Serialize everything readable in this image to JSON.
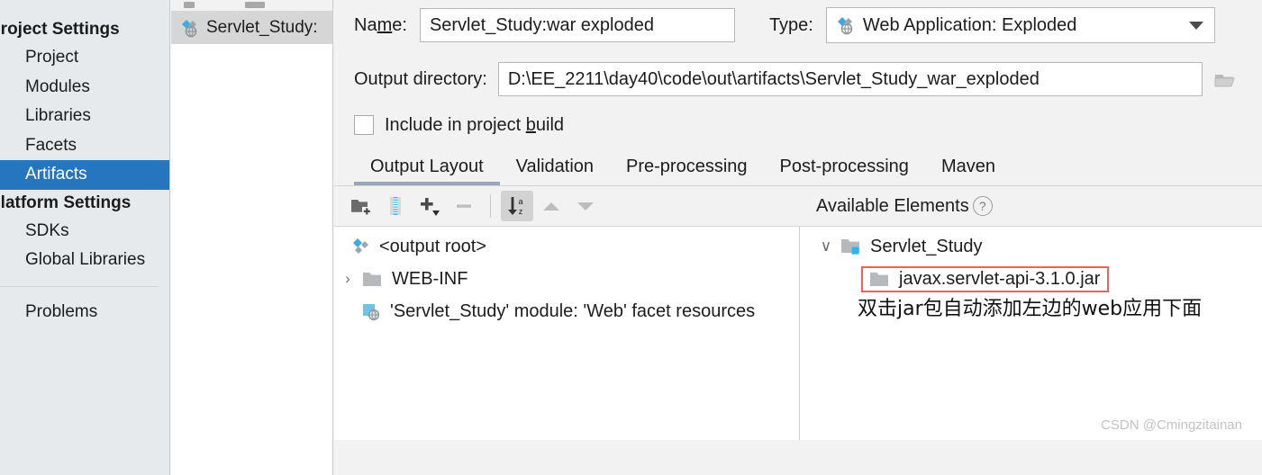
{
  "sidebar": {
    "groups": [
      {
        "label": "Project Settings",
        "items": [
          {
            "label": "Project",
            "selected": false
          },
          {
            "label": "Modules",
            "selected": false
          },
          {
            "label": "Libraries",
            "selected": false
          },
          {
            "label": "Facets",
            "selected": false
          },
          {
            "label": "Artifacts",
            "selected": true
          }
        ]
      },
      {
        "label": "Platform Settings",
        "items": [
          {
            "label": "SDKs",
            "selected": false
          },
          {
            "label": "Global Libraries",
            "selected": false
          }
        ]
      }
    ],
    "problems_label": "Problems"
  },
  "artifact_list": {
    "items": [
      {
        "label": "Servlet_Study:",
        "icon": "web-application-exploded-icon",
        "selected": true
      }
    ]
  },
  "form": {
    "name_label_pre": "Na",
    "name_label_mnemonic": "m",
    "name_label_post": "e:",
    "name_value": "Servlet_Study:war exploded",
    "type_label": "Type:",
    "type_value": "Web Application: Exploded",
    "output_label": "Output directory:",
    "output_value": "D:\\EE_2211\\day40\\code\\out\\artifacts\\Servlet_Study_war_exploded",
    "browse_icon": "folder-browse-icon",
    "include_label_pre": "Include in project ",
    "include_label_mnemonic": "b",
    "include_label_post": "uild",
    "include_checked": false
  },
  "tabs": [
    {
      "label": "Output Layout",
      "active": true
    },
    {
      "label": "Validation",
      "active": false
    },
    {
      "label": "Pre-processing",
      "active": false
    },
    {
      "label": "Post-processing",
      "active": false
    },
    {
      "label": "Maven",
      "active": false
    }
  ],
  "toolbar": {
    "buttons": [
      {
        "name": "create-directory-button",
        "icon": "new-folder-icon",
        "enabled": true,
        "pressed": false
      },
      {
        "name": "create-archive-button",
        "icon": "archive-zip-icon",
        "enabled": true,
        "pressed": false
      },
      {
        "name": "add-copy-of-button",
        "icon": "plus-dropdown-icon",
        "enabled": true,
        "pressed": false
      },
      {
        "name": "remove-button",
        "icon": "minus-icon",
        "enabled": false,
        "pressed": false
      },
      {
        "name": "sort-elements-button",
        "icon": "sort-az-icon",
        "enabled": true,
        "pressed": true
      },
      {
        "name": "move-up-button",
        "icon": "arrow-up-icon",
        "enabled": false,
        "pressed": false
      },
      {
        "name": "move-down-button",
        "icon": "arrow-down-icon",
        "enabled": false,
        "pressed": false
      }
    ],
    "available_elements_label": "Available Elements",
    "help_icon": "question-mark-icon"
  },
  "output_tree": {
    "nodes": [
      {
        "label": "<output root>",
        "icon": "artifact-output-root-icon",
        "twisty": "",
        "indent": 0
      },
      {
        "label": "WEB-INF",
        "icon": "folder-icon",
        "twisty": "›",
        "indent": 0
      },
      {
        "label": "'Servlet_Study' module: 'Web' facet resources",
        "icon": "web-facet-icon",
        "twisty": "",
        "indent": 1
      }
    ]
  },
  "available_tree": {
    "nodes": [
      {
        "label": "Servlet_Study",
        "icon": "module-folder-icon",
        "twisty": "∨",
        "indent": 0,
        "highlighted": false
      },
      {
        "label": "javax.servlet-api-3.1.0.jar",
        "icon": "folder-icon",
        "twisty": "",
        "indent": 1,
        "highlighted": true
      }
    ]
  },
  "annotation": {
    "text": "双击jar包自动添加左边的web应用下面",
    "box_color": "#f2605c"
  },
  "watermark": "CSDN @Cmingzitainan",
  "colors": {
    "accent_selection": "#2675bf",
    "sidebar_bg": "#e6eaec",
    "panel_bg": "#f2f2f2",
    "tab_underline": "#98a7b8",
    "annotation_red": "#f2605c"
  }
}
